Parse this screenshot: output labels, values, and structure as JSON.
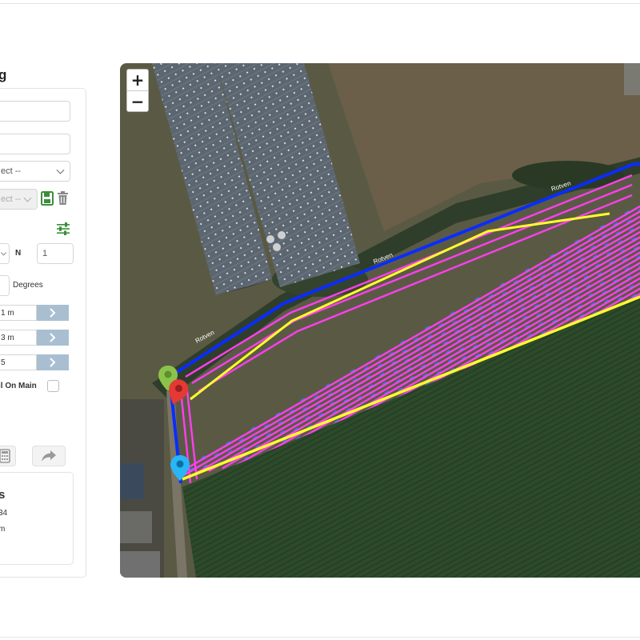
{
  "panel": {
    "title": "g",
    "select_1": "ect --",
    "select_2": "ect --",
    "n_label": "N",
    "n_value": "1",
    "degrees_label": "Degrees",
    "step_1": "1 m",
    "step_2": "3 m",
    "step_3": "5",
    "checkbox_label": "il On Main",
    "info_title": "s",
    "info_value_1": "34",
    "info_value_2": "m"
  },
  "map": {
    "zoom_in": "+",
    "zoom_out": "−",
    "road_label_1": "Rotven",
    "road_label_2": "Rotven",
    "road_label_3": "Rotven"
  },
  "colors": {
    "boundary": "#0a2cff",
    "headland": "#ff3ef0",
    "ab_line": "#ffff2a",
    "field": "#2c4a2a",
    "accent_green": "#3a8f3a",
    "stepper": "#a9bfd1"
  }
}
